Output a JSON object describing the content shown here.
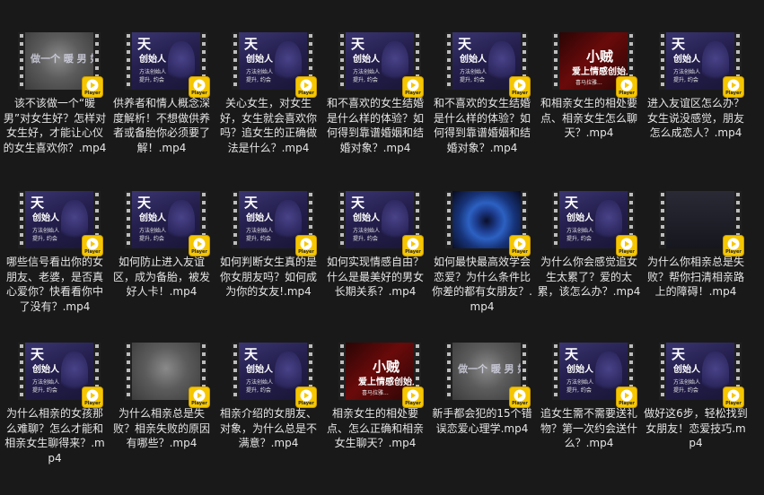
{
  "badge_label": "Player",
  "items": [
    {
      "name": "该不该做一个“暖男”对女生好？怎样对女生好，才能让心仪的女生喜欢你？.mp4",
      "thumb": "blur",
      "cap": [
        "做一个 暖 男 好吗"
      ]
    },
    {
      "name": "供养者和情人概念深度解析！不想做供养者或备胎你必须要了解！.mp4",
      "thumb": "dark",
      "cap": [
        "天",
        "创始人",
        "方法创始人",
        "提升, 约会"
      ]
    },
    {
      "name": "关心女生，对女生好，女生就会喜欢你吗？追女生的正确做法是什么？.mp4",
      "thumb": "dark",
      "cap": [
        "天",
        "创始人",
        "方法创始人",
        "提升, 约会"
      ]
    },
    {
      "name": "和不喜欢的女生结婚是什么样的体验？如何得到靠谱婚姻和结婚对象？.mp4",
      "thumb": "dark",
      "cap": [
        "天",
        "创始人",
        "方法创始人",
        "提升, 约会"
      ]
    },
    {
      "name": "和不喜欢的女生结婚是什么样的体验？如何得到靠谱婚姻和结婚对象？.mp4",
      "thumb": "dark",
      "cap": [
        "天",
        "创始人",
        "方法创始人",
        "提升, 约会"
      ]
    },
    {
      "name": "和相亲女生的相处要点、相亲女生怎么聊天？.mp4",
      "thumb": "red",
      "cap": [
        "小贼",
        "爱上情感创始人",
        "喜马拉雅..."
      ]
    },
    {
      "name": "进入友谊区怎么办？女生说没感觉，朋友怎么成恋人？.mp4",
      "thumb": "dark",
      "cap": [
        "天",
        "创始人",
        "方法创始人",
        "提升, 约会"
      ]
    },
    {
      "name": "哪些信号看出你的女朋友、老婆，是否真心爱你？快看看你中了没有？.mp4",
      "thumb": "dark",
      "cap": [
        "天",
        "创始人",
        "方法创始人",
        "提升, 约会"
      ]
    },
    {
      "name": "如何防止进入友谊区，成为备胎，被发好人卡！.mp4",
      "thumb": "dark",
      "cap": [
        "天",
        "创始人",
        "方法创始人",
        "提升, 约会"
      ]
    },
    {
      "name": "如何判断女生真的是你女朋友吗？如何成为你的女友!.mp4",
      "thumb": "dark",
      "cap": [
        "天",
        "创始人",
        "方法创始人",
        "提升, 约会"
      ]
    },
    {
      "name": "如何实现情感自由？什么是最美好的男女长期关系？.mp4",
      "thumb": "dark",
      "cap": [
        "天",
        "创始人",
        "方法创始人",
        "提升, 约会"
      ]
    },
    {
      "name": "如何最快最高效学会恋爱？为什么条件比你差的都有女朋友？.mp4",
      "thumb": "tunnel",
      "cap": []
    },
    {
      "name": "为什么你会感觉追女生太累了？爱的太累，该怎么办？.mp4",
      "thumb": "dark",
      "cap": [
        "天",
        "创始人",
        "方法创始人",
        "提升, 约会"
      ]
    },
    {
      "name": "为什么你相亲总是失败？帮你扫清相亲路上的障碍！.mp4",
      "thumb": "slate",
      "cap": []
    },
    {
      "name": "为什么相亲的女孩那么难聊？怎么才能和相亲女生聊得来？.mp4",
      "thumb": "dark",
      "cap": [
        "天",
        "创始人",
        "方法创始人",
        "提升, 约会"
      ]
    },
    {
      "name": "为什么相亲总是失败？相亲失败的原因有哪些？.mp4",
      "thumb": "blur",
      "cap": []
    },
    {
      "name": "相亲介绍的女朋友、对象，为什么总是不满意？.mp4",
      "thumb": "dark",
      "cap": [
        "天",
        "创始人",
        "方法创始人",
        "提升, 约会"
      ]
    },
    {
      "name": "相亲女生的相处要点、怎么正确和相亲女生聊天？.mp4",
      "thumb": "red",
      "cap": [
        "小贼",
        "爱上情感创始人",
        "喜马拉雅..."
      ]
    },
    {
      "name": "新手都会犯的15个错误恋爱心理学.mp4",
      "thumb": "blur",
      "cap": [
        "做一个 暖 男 好吗"
      ]
    },
    {
      "name": "追女生需不需要送礼物？第一次约会送什么？.mp4",
      "thumb": "dark",
      "cap": [
        "天",
        "创始人",
        "方法创始人",
        "提升, 约会"
      ]
    },
    {
      "name": "做好这6步，轻松找到女朋友！恋爱技巧.mp4",
      "thumb": "dark",
      "cap": [
        "天",
        "创始人",
        "方法创始人",
        "提升, 约会"
      ]
    }
  ]
}
